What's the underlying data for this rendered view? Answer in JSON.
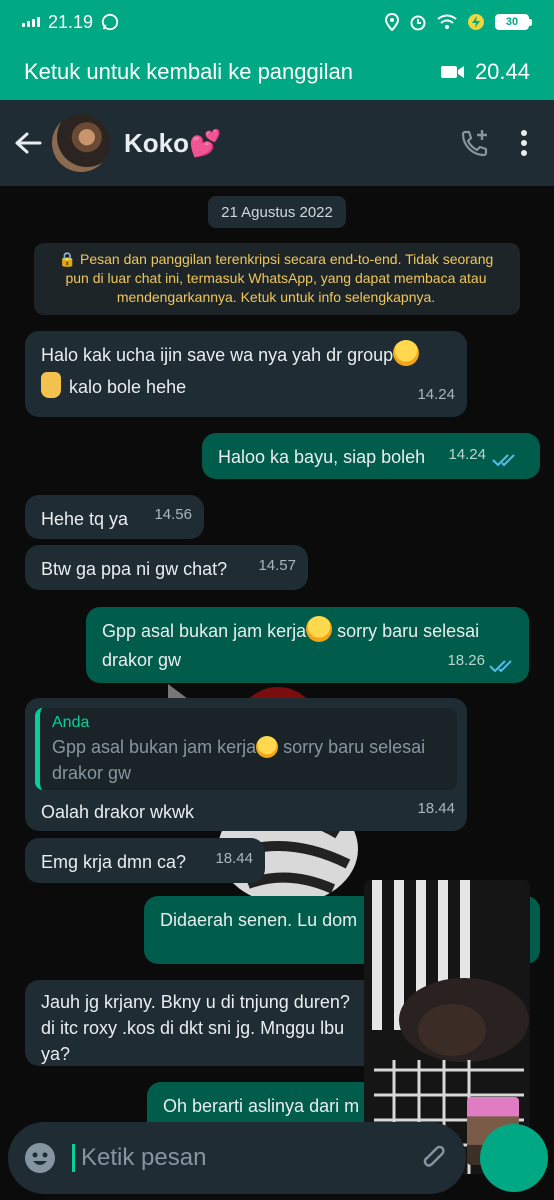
{
  "status_bar": {
    "time": "21.19",
    "battery": "30"
  },
  "call_banner": {
    "label": "Ketuk untuk kembali ke panggilan",
    "duration": "20.44"
  },
  "header": {
    "contact_name": "Koko💕"
  },
  "chat": {
    "date": "21 Agustus 2022",
    "encryption_notice": "🔒 Pesan dan panggilan terenkripsi secara end-to-end. Tidak seorang pun di luar chat ini, termasuk WhatsApp, yang dapat membaca atau mendengarkannya. Ketuk untuk info selengkapnya.",
    "messages": [
      {
        "dir": "in",
        "line1": "Halo kak ucha ijin save wa nya yah dr group",
        "line2": "kalo bole hehe",
        "time": "14.24"
      },
      {
        "dir": "out",
        "text": "Haloo ka bayu, siap boleh",
        "time": "14.24"
      },
      {
        "dir": "in",
        "text": "Hehe tq ya",
        "time": "14.56"
      },
      {
        "dir": "in",
        "text": "Btw ga ppa ni gw chat?",
        "time": "14.57"
      },
      {
        "dir": "out",
        "line1a": "Gpp asal bukan jam kerja",
        "line1b": " sorry baru selesai",
        "line2": "drakor gw",
        "time": "18.26"
      },
      {
        "dir": "in",
        "quote_author": "Anda",
        "quote_line1a": "Gpp asal bukan jam kerja",
        "quote_line1b": " sorry baru selesai",
        "quote_line2": "drakor gw",
        "text": "Oalah drakor wkwk",
        "time": "18.44"
      },
      {
        "dir": "in",
        "text": "Emg krja dmn ca?",
        "time": "18.44"
      },
      {
        "dir": "out",
        "text": "Didaerah senen. Lu dom"
      },
      {
        "dir": "in",
        "line1": "Jauh jg krjany. Bkny u di tnjung duren?",
        "line2": "di itc roxy .kos di dkt sni jg.  Mnggu lbu",
        "line3": "ya?"
      },
      {
        "dir": "out",
        "text": "Oh berarti aslinya dari m"
      }
    ]
  },
  "input": {
    "placeholder": "Ketik pesan"
  },
  "colors": {
    "accent": "#00a884",
    "incoming": "#1f2c34",
    "outgoing": "#005c4b",
    "read_ticks": "#53bdeb"
  }
}
